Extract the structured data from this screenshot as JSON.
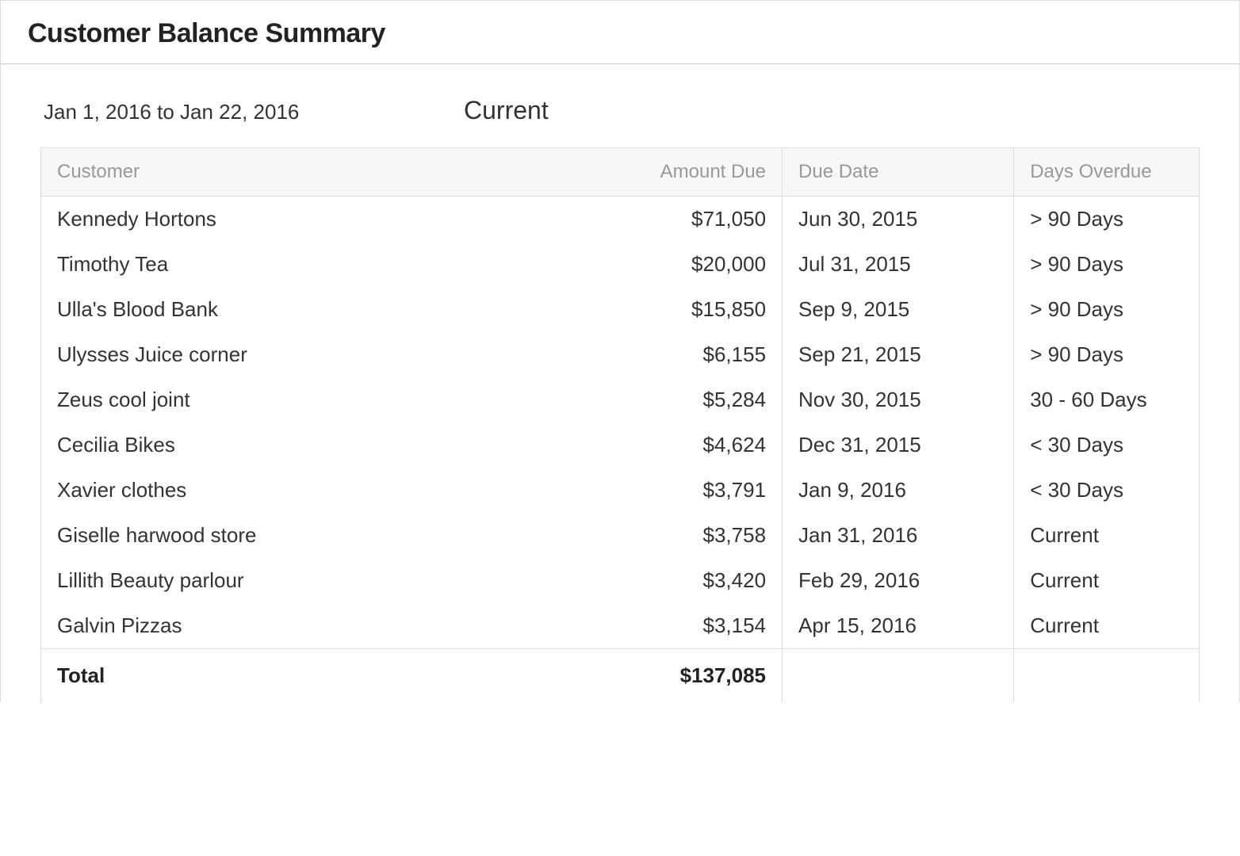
{
  "header": {
    "title": "Customer Balance Summary"
  },
  "meta": {
    "date_range": "Jan 1, 2016 to Jan 22, 2016",
    "status_label": "Current"
  },
  "columns": {
    "customer": "Customer",
    "amount_due": "Amount Due",
    "due_date": "Due Date",
    "days_overdue": "Days Overdue"
  },
  "rows": [
    {
      "customer": "Kennedy Hortons",
      "amount_due": "$71,050",
      "due_date": "Jun 30, 2015",
      "days_overdue": "> 90 Days",
      "overdue_status": "red"
    },
    {
      "customer": "Timothy Tea",
      "amount_due": "$20,000",
      "due_date": "Jul 31, 2015",
      "days_overdue": "> 90 Days",
      "overdue_status": "red"
    },
    {
      "customer": "Ulla's Blood Bank",
      "amount_due": "$15,850",
      "due_date": "Sep 9, 2015",
      "days_overdue": "> 90 Days",
      "overdue_status": "red"
    },
    {
      "customer": "Ulysses Juice corner",
      "amount_due": "$6,155",
      "due_date": "Sep 21, 2015",
      "days_overdue": "> 90 Days",
      "overdue_status": "red"
    },
    {
      "customer": "Zeus cool joint",
      "amount_due": "$5,284",
      "due_date": "Nov 30, 2015",
      "days_overdue": "30 - 60 Days",
      "overdue_status": "red"
    },
    {
      "customer": "Cecilia Bikes",
      "amount_due": "$4,624",
      "due_date": "Dec 31, 2015",
      "days_overdue": "< 30 Days",
      "overdue_status": "red"
    },
    {
      "customer": "Xavier clothes",
      "amount_due": "$3,791",
      "due_date": "Jan 9, 2016",
      "days_overdue": "< 30 Days",
      "overdue_status": "red"
    },
    {
      "customer": "Giselle harwood store",
      "amount_due": "$3,758",
      "due_date": "Jan 31, 2016",
      "days_overdue": "Current",
      "overdue_status": "green"
    },
    {
      "customer": "Lillith Beauty parlour",
      "amount_due": "$3,420",
      "due_date": "Feb 29, 2016",
      "days_overdue": "Current",
      "overdue_status": "green"
    },
    {
      "customer": "Galvin Pizzas",
      "amount_due": "$3,154",
      "due_date": "Apr 15, 2016",
      "days_overdue": "Current",
      "overdue_status": "green"
    }
  ],
  "total": {
    "label": "Total",
    "amount": "$137,085"
  }
}
